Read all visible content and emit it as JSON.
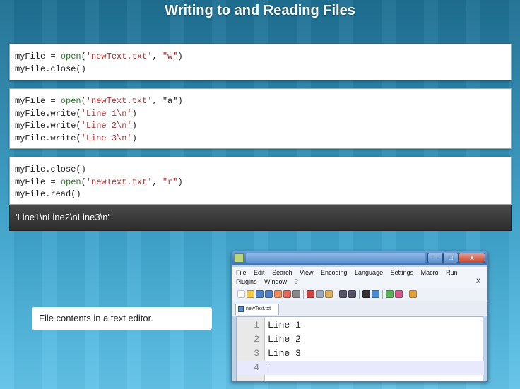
{
  "slide": {
    "title": "Writing to and Reading Files"
  },
  "code_blocks": [
    {
      "lines": [
        [
          "myFile = ",
          "open",
          "(",
          "'newText.txt'",
          ", ",
          "\"w\"",
          ")"
        ],
        [
          "myFile.close()"
        ]
      ]
    },
    {
      "lines": [
        [
          "myFile = ",
          "open",
          "(",
          "'newText.txt'",
          ", \"a\")"
        ],
        [
          "myFile.write(",
          "'Line 1\\n'",
          ")"
        ],
        [
          "myFile.write(",
          "'Line 2\\n'",
          ")"
        ],
        [
          "myFile.write(",
          "'Line 3\\n'",
          ")"
        ]
      ]
    },
    {
      "lines": [
        [
          "myFile.close()"
        ],
        [
          "myFile = ",
          "open",
          "(",
          "'newText.txt'",
          ", ",
          "\"r\"",
          ")"
        ],
        [
          "myFile.read()"
        ]
      ]
    }
  ],
  "output": {
    "text": "'Line1\\nLine2\\nLine3\\n'"
  },
  "caption": {
    "text": "File contents in a text editor."
  },
  "editor": {
    "menu_row1": [
      "File",
      "Edit",
      "Search",
      "View",
      "Encoding",
      "Language",
      "Settings",
      "Macro",
      "Run"
    ],
    "menu_row2": [
      "Plugins",
      "Window",
      "?"
    ],
    "close_label": "X",
    "tab_label": "newText.txt",
    "lines": [
      {
        "num": "1",
        "text": "Line 1"
      },
      {
        "num": "2",
        "text": "Line 2"
      },
      {
        "num": "3",
        "text": "Line 3"
      },
      {
        "num": "4",
        "text": ""
      }
    ],
    "min_label": "–",
    "max_label": "□",
    "win_close_label": "x"
  },
  "colors": {
    "keyword": "#2d7a2d",
    "string": "#b23030"
  }
}
